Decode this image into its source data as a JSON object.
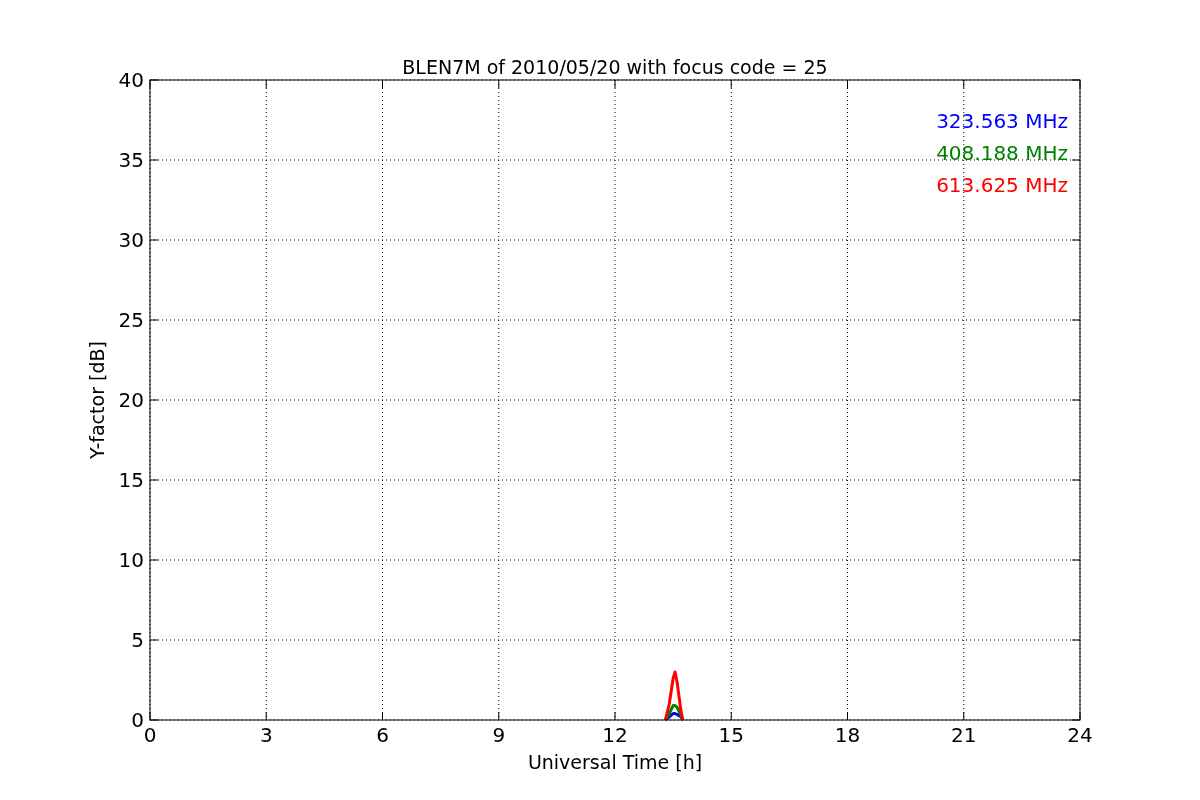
{
  "figure": {
    "chart_data": {
      "type": "line",
      "title": "BLEN7M of 2010/05/20 with focus code = 25",
      "xlabel": "Universal Time [h]",
      "ylabel": "Y-factor [dB]",
      "x": [
        13.3,
        13.4,
        13.5,
        13.55,
        13.6,
        13.7,
        13.75
      ],
      "series": [
        {
          "name": "323.563 MHz",
          "color": "#0000ff",
          "values": [
            0,
            0.2,
            0.4,
            0.4,
            0.35,
            0.2,
            0
          ]
        },
        {
          "name": "408.188 MHz",
          "color": "#008000",
          "values": [
            0,
            0.4,
            0.9,
            0.9,
            0.8,
            0.3,
            0
          ]
        },
        {
          "name": "613.625 MHz",
          "color": "#ff0000",
          "values": [
            0,
            1.0,
            2.6,
            3.0,
            2.4,
            0.6,
            0
          ]
        }
      ],
      "xlim": [
        0,
        24
      ],
      "ylim": [
        0,
        40
      ],
      "xticks": [
        0,
        3,
        6,
        9,
        12,
        15,
        18,
        21,
        24
      ],
      "yticks": [
        0,
        5,
        10,
        15,
        20,
        25,
        30,
        35,
        40
      ],
      "grid": true
    }
  }
}
